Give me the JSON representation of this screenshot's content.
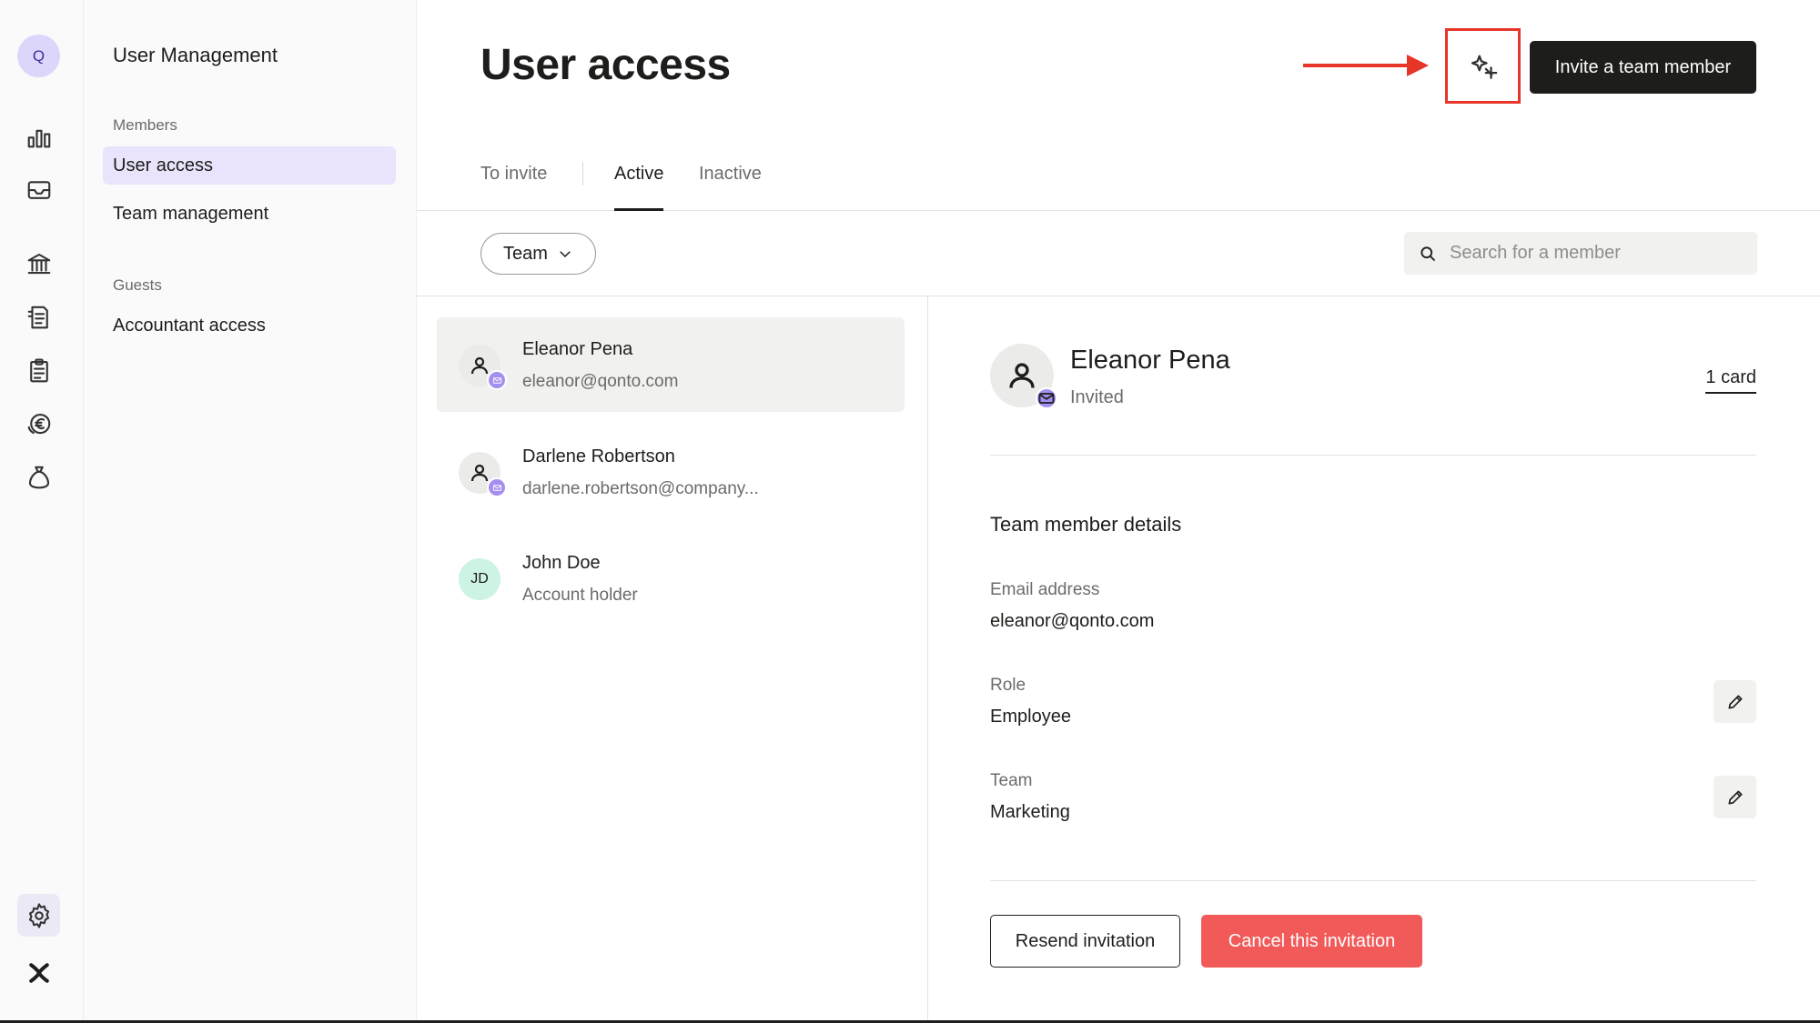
{
  "rail": {
    "avatar_initial": "Q",
    "icons": [
      "chart-bars-icon",
      "inbox-icon",
      "bank-icon",
      "invoice-icon",
      "clipboard-icon",
      "euro-coin-icon",
      "money-bag-icon",
      "gear-icon",
      "logo-icon"
    ]
  },
  "subnav": {
    "title": "User Management",
    "sections": [
      {
        "label": "Members",
        "items": [
          {
            "label": "User access",
            "active": true
          },
          {
            "label": "Team management",
            "active": false
          }
        ]
      },
      {
        "label": "Guests",
        "items": [
          {
            "label": "Accountant access",
            "active": false
          }
        ]
      }
    ]
  },
  "header": {
    "title": "User access",
    "highlight_icon": "sparkle-plus-icon",
    "invite_label": "Invite a team member",
    "accent_color": "#e8352a"
  },
  "tabs": [
    {
      "label": "To invite",
      "active": false
    },
    {
      "label": "Active",
      "active": true
    },
    {
      "label": "Inactive",
      "active": false
    }
  ],
  "filters": {
    "team_label": "Team",
    "search_placeholder": "Search for a member"
  },
  "members": [
    {
      "name": "Eleanor Pena",
      "sub": "eleanor@qonto.com",
      "avatar": "person-icon",
      "badge": true,
      "active": true
    },
    {
      "name": "Darlene Robertson",
      "sub": "darlene.robertson@company...",
      "avatar": "person-icon",
      "badge": true,
      "active": false
    },
    {
      "name": "John Doe",
      "sub": "Account holder",
      "initials": "JD",
      "badge": false,
      "active": false
    }
  ],
  "detail": {
    "name": "Eleanor Pena",
    "status": "Invited",
    "cards_link": "1 card",
    "section_title": "Team member details",
    "fields": [
      {
        "label": "Email address",
        "value": "eleanor@qonto.com",
        "editable": false
      },
      {
        "label": "Role",
        "value": "Employee",
        "editable": true
      },
      {
        "label": "Team",
        "value": "Marketing",
        "editable": true
      }
    ],
    "resend_label": "Resend invitation",
    "cancel_label": "Cancel this invitation",
    "danger_color": "#f25a5a"
  }
}
